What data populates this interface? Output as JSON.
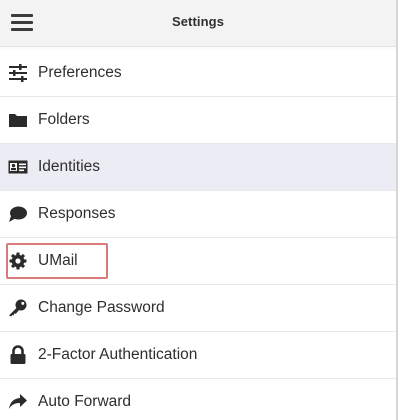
{
  "header": {
    "title": "Settings"
  },
  "menu": {
    "items": [
      {
        "label": "Preferences",
        "icon": "sliders-icon"
      },
      {
        "label": "Folders",
        "icon": "folder-icon"
      },
      {
        "label": "Identities",
        "icon": "id-card-icon"
      },
      {
        "label": "Responses",
        "icon": "speech-bubble-icon"
      },
      {
        "label": "UMail",
        "icon": "gear-icon"
      },
      {
        "label": "Change Password",
        "icon": "key-icon"
      },
      {
        "label": "2-Factor Authentication",
        "icon": "lock-icon"
      },
      {
        "label": "Auto Forward",
        "icon": "forward-arrow-icon"
      }
    ],
    "active_item": "Identities",
    "highlighted_item": "UMail"
  },
  "colors": {
    "active_row": "#ececf4",
    "highlight_border": "#d9797a",
    "icon": "#2b2b2b"
  }
}
